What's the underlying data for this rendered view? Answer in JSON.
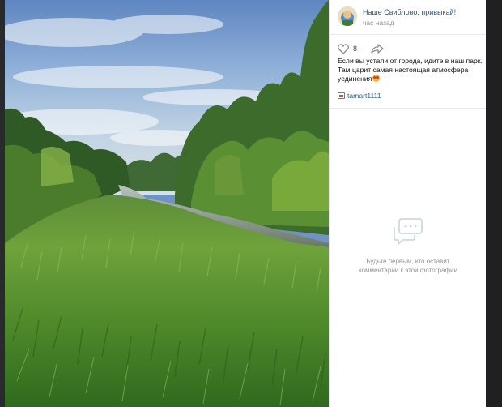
{
  "post": {
    "author_name": "Наше Свиблово, привыкай!",
    "time": "час назад",
    "likes": "8",
    "text_lines": [
      "Если вы устали от города, идите в наш парк.",
      "Там царит самая настоящая атмосфера",
      "уединения"
    ],
    "emoji": "heart-eyes-emoji",
    "tag": "tamart1111"
  },
  "comments": {
    "empty_line_1": "Будьте первым, кто оставит",
    "empty_line_2": "комментарий к этой фотографии"
  },
  "colors": {
    "link": "#2a5885",
    "muted": "#939393",
    "panel_bg": "#ffffff",
    "page_bg": "#202022"
  },
  "icons": {
    "like": "heart-icon",
    "share": "share-arrow-icon",
    "tag": "photo-tag-icon",
    "comments_empty": "chat-bubble-icon"
  }
}
